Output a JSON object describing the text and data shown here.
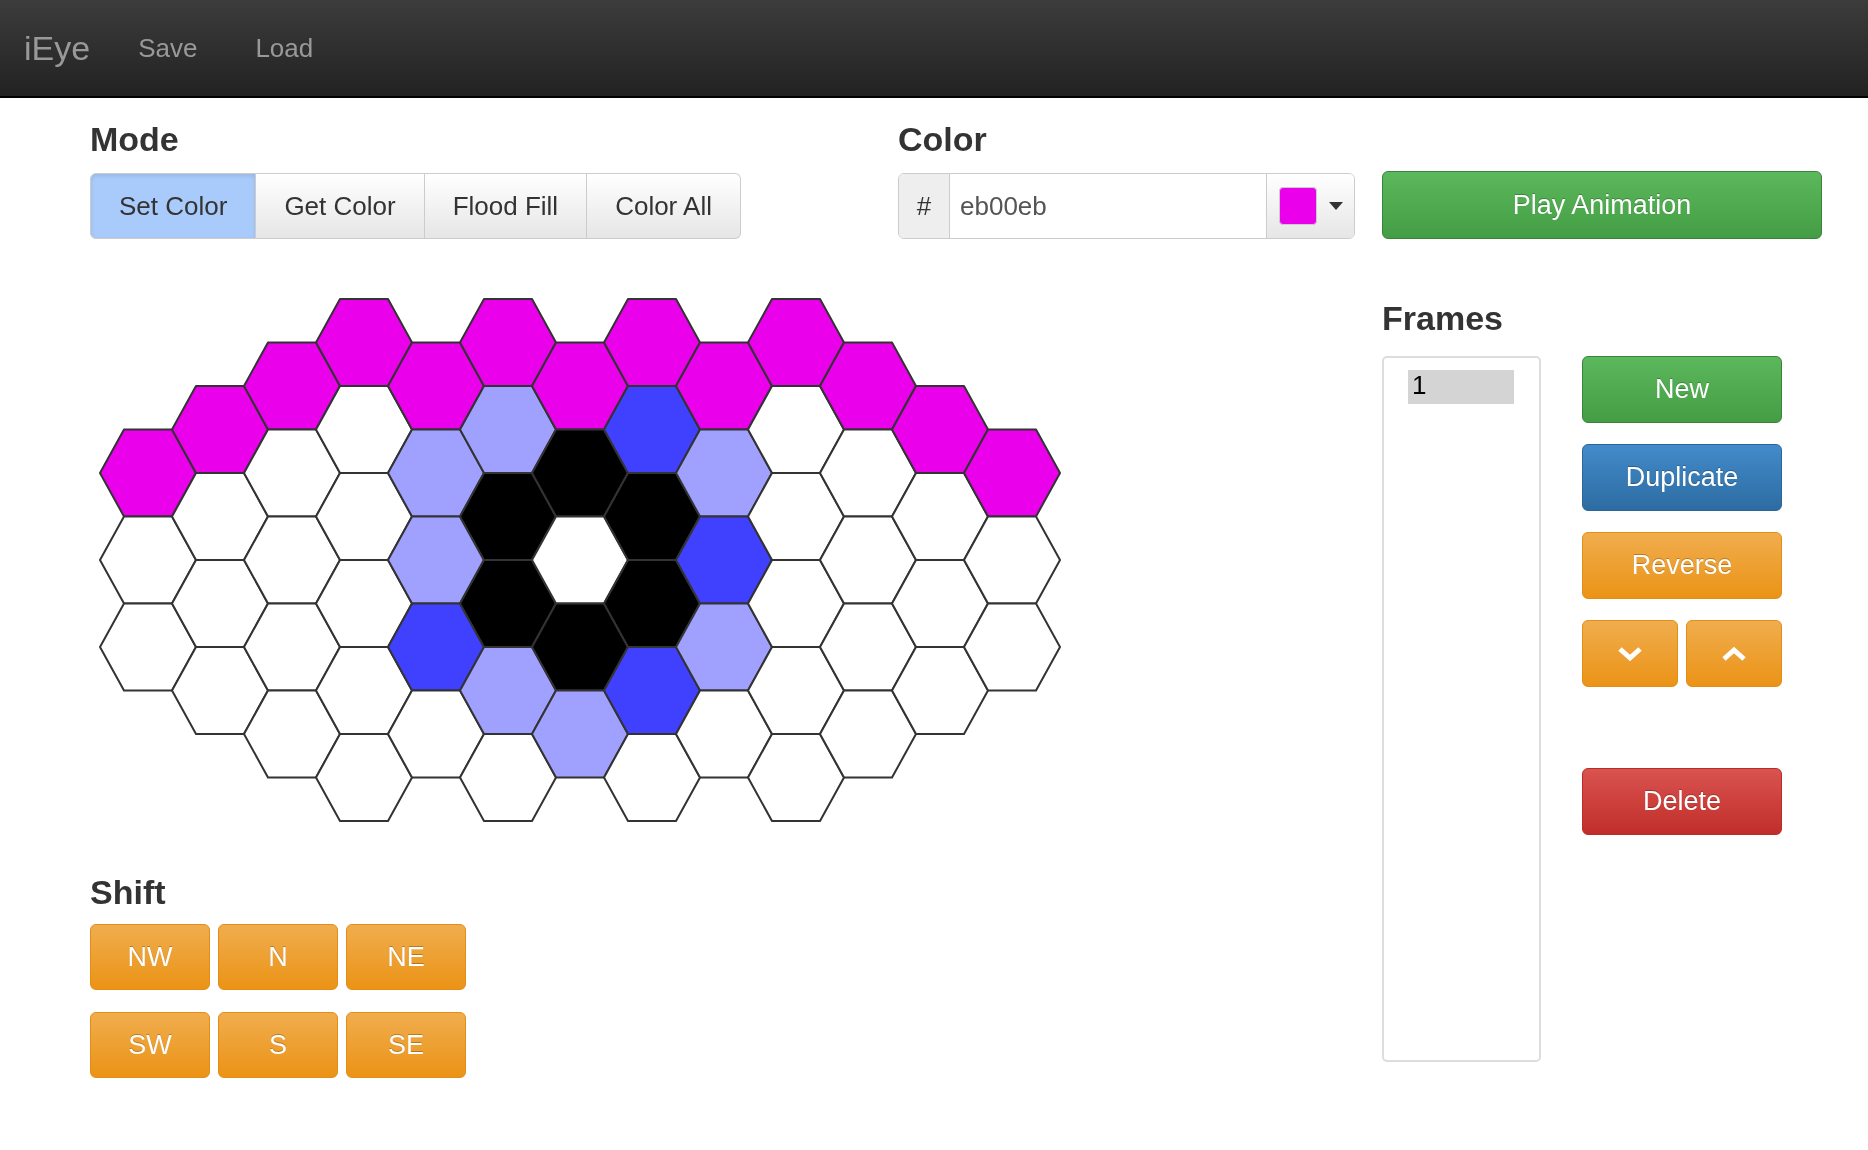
{
  "navbar": {
    "brand": "iEye",
    "links": [
      "Save",
      "Load"
    ]
  },
  "mode": {
    "title": "Mode",
    "options": [
      {
        "label": "Set Color",
        "selected": true
      },
      {
        "label": "Get Color",
        "selected": false
      },
      {
        "label": "Flood Fill",
        "selected": false
      },
      {
        "label": "Color All",
        "selected": false
      }
    ]
  },
  "color": {
    "title": "Color",
    "prefix": "#",
    "value": "eb00eb",
    "color": "#eb00eb"
  },
  "play_button": "Play Animation",
  "grid": {
    "columns": [
      {
        "cells": [
          {
            "color": "#eb00eb"
          },
          {
            "color": "#ffffff"
          },
          {
            "color": "#ffffff"
          }
        ]
      },
      {
        "cells": [
          {
            "color": "#eb00eb"
          },
          {
            "color": "#ffffff"
          },
          {
            "color": "#ffffff"
          },
          {
            "color": "#ffffff"
          }
        ]
      },
      {
        "cells": [
          {
            "color": "#eb00eb"
          },
          {
            "color": "#ffffff"
          },
          {
            "color": "#ffffff"
          },
          {
            "color": "#ffffff"
          },
          {
            "color": "#ffffff"
          }
        ]
      },
      {
        "cells": [
          {
            "color": "#eb00eb"
          },
          {
            "color": "#ffffff"
          },
          {
            "color": "#ffffff"
          },
          {
            "color": "#ffffff"
          },
          {
            "color": "#ffffff"
          },
          {
            "color": "#ffffff"
          }
        ]
      },
      {
        "cells": [
          {
            "color": "#eb00eb"
          },
          {
            "color": "#a0a0ff"
          },
          {
            "color": "#a0a0ff"
          },
          {
            "color": "#4040ff"
          },
          {
            "color": "#ffffff"
          }
        ]
      },
      {
        "cells": [
          {
            "color": "#eb00eb"
          },
          {
            "color": "#a0a0ff"
          },
          {
            "color": "#000000"
          },
          {
            "color": "#000000"
          },
          {
            "color": "#a0a0ff"
          },
          {
            "color": "#ffffff"
          }
        ]
      },
      {
        "cells": [
          {
            "color": "#eb00eb"
          },
          {
            "color": "#000000"
          },
          {
            "color": "#ffffff"
          },
          {
            "color": "#000000"
          },
          {
            "color": "#a0a0ff"
          }
        ]
      },
      {
        "cells": [
          {
            "color": "#eb00eb"
          },
          {
            "color": "#4040ff"
          },
          {
            "color": "#000000"
          },
          {
            "color": "#000000"
          },
          {
            "color": "#4040ff"
          },
          {
            "color": "#ffffff"
          }
        ]
      },
      {
        "cells": [
          {
            "color": "#eb00eb"
          },
          {
            "color": "#a0a0ff"
          },
          {
            "color": "#4040ff"
          },
          {
            "color": "#a0a0ff"
          },
          {
            "color": "#ffffff"
          }
        ]
      },
      {
        "cells": [
          {
            "color": "#eb00eb"
          },
          {
            "color": "#ffffff"
          },
          {
            "color": "#ffffff"
          },
          {
            "color": "#ffffff"
          },
          {
            "color": "#ffffff"
          },
          {
            "color": "#ffffff"
          }
        ]
      },
      {
        "cells": [
          {
            "color": "#eb00eb"
          },
          {
            "color": "#ffffff"
          },
          {
            "color": "#ffffff"
          },
          {
            "color": "#ffffff"
          },
          {
            "color": "#ffffff"
          }
        ]
      },
      {
        "cells": [
          {
            "color": "#eb00eb"
          },
          {
            "color": "#ffffff"
          },
          {
            "color": "#ffffff"
          },
          {
            "color": "#ffffff"
          }
        ]
      },
      {
        "cells": [
          {
            "color": "#eb00eb"
          },
          {
            "color": "#ffffff"
          },
          {
            "color": "#ffffff"
          }
        ]
      }
    ]
  },
  "shift": {
    "title": "Shift",
    "buttons": [
      "NW",
      "N",
      "NE",
      "SW",
      "S",
      "SE"
    ]
  },
  "frames": {
    "title": "Frames",
    "items": [
      {
        "label": "1",
        "selected": true
      }
    ],
    "buttons": [
      {
        "kind": "success",
        "label": "New"
      },
      {
        "kind": "primary",
        "label": "Duplicate"
      },
      {
        "kind": "warning",
        "label": "Reverse"
      }
    ],
    "delete_button": "Delete"
  }
}
